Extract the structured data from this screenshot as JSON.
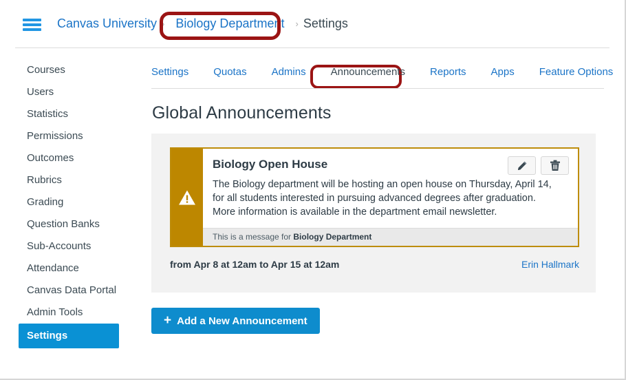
{
  "header": {
    "menu_icon": "hamburger-menu-icon",
    "breadcrumb": {
      "root": "Canvas University",
      "separator": "›",
      "middle": "Biology Department",
      "current": "Settings"
    }
  },
  "sidebar": {
    "items": [
      {
        "label": "Courses",
        "active": false
      },
      {
        "label": "Users",
        "active": false
      },
      {
        "label": "Statistics",
        "active": false
      },
      {
        "label": "Permissions",
        "active": false
      },
      {
        "label": "Outcomes",
        "active": false
      },
      {
        "label": "Rubrics",
        "active": false
      },
      {
        "label": "Grading",
        "active": false
      },
      {
        "label": "Question Banks",
        "active": false
      },
      {
        "label": "Sub-Accounts",
        "active": false
      },
      {
        "label": "Attendance",
        "active": false
      },
      {
        "label": "Canvas Data Portal",
        "active": false
      },
      {
        "label": "Admin Tools",
        "active": false
      },
      {
        "label": "Settings",
        "active": true
      }
    ]
  },
  "tabs": [
    {
      "label": "Settings",
      "active": false
    },
    {
      "label": "Quotas",
      "active": false
    },
    {
      "label": "Admins",
      "active": false
    },
    {
      "label": "Announcements",
      "active": true
    },
    {
      "label": "Reports",
      "active": false
    },
    {
      "label": "Apps",
      "active": false
    },
    {
      "label": "Feature Options",
      "active": false
    }
  ],
  "main": {
    "page_title": "Global Announcements",
    "announcement": {
      "icon": "warning-triangle-icon",
      "title": "Biology Open House",
      "body": "The Biology department will be hosting an open house on Thursday, April 14, for all students interested in pursuing advanced degrees after graduation. More information is available in the department email newsletter.",
      "footer_prefix": "This is a message for ",
      "footer_target": "Biology Department",
      "edit_button": "edit-announcement-button",
      "delete_button": "delete-announcement-button",
      "dates": "from Apr 8 at 12am to Apr 15 at 12am",
      "author": "Erin Hallmark"
    },
    "add_button": {
      "icon": "plus-icon",
      "label": "Add a New Announcement"
    }
  },
  "annotations": [
    {
      "name": "breadcrumb-highlight",
      "target": "Biology Department"
    },
    {
      "name": "tab-highlight",
      "target": "Announcements"
    }
  ],
  "colors": {
    "link": "#1b74c7",
    "accent": "#0a91d4",
    "announcement_gold": "#bd8700",
    "annotation_red": "#9b1414",
    "panel_gray": "#f2f2f2"
  }
}
